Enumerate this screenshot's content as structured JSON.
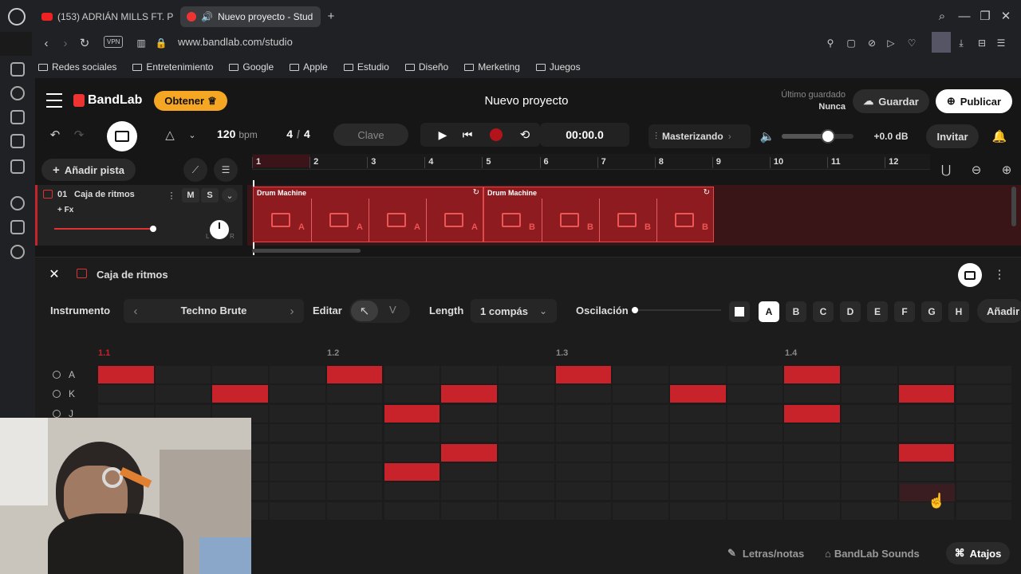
{
  "browser": {
    "tabs": [
      {
        "label": "(153) ADRIÁN MILLS FT. P"
      },
      {
        "label": "Nuevo proyecto - Stud"
      }
    ],
    "url": "www.bandlab.com/studio",
    "vpn": "VPN",
    "bookmarks": [
      {
        "label": "Redes sociales"
      },
      {
        "label": "Entretenimiento"
      },
      {
        "label": "Google"
      },
      {
        "label": "Apple"
      },
      {
        "label": "Estudio"
      },
      {
        "label": "Diseño"
      },
      {
        "label": "Merketing"
      },
      {
        "label": "Juegos"
      }
    ]
  },
  "header": {
    "logo": "BandLab",
    "get_button": "Obtener",
    "project_title": "Nuevo proyecto",
    "last_saved_label": "Último guardado",
    "last_saved_value": "Nunca",
    "save_button": "Guardar",
    "publish_button": "Publicar"
  },
  "transport": {
    "tempo": "120",
    "tempo_unit": "bpm",
    "time_sig_num": "4",
    "time_sig_sep": "/",
    "time_sig_den": "4",
    "key_button": "Clave",
    "time": "00:00.0",
    "mastering": "Masterizando",
    "volume_db": "+0.0 dB",
    "invite": "Invitar",
    "master_volume_fraction": 0.65
  },
  "tracks": {
    "add_track": "Añadir pista",
    "track": {
      "number": "01",
      "name": "Caja de ritmos",
      "fx": "+ Fx",
      "mute": "M",
      "solo": "S",
      "pan_l": "L",
      "pan_r": "R",
      "volume_fraction": 1.0
    }
  },
  "ruler": [
    "1",
    "2",
    "3",
    "4",
    "5",
    "6",
    "7",
    "8",
    "9",
    "10",
    "11",
    "12"
  ],
  "regions": [
    {
      "title": "Drum Machine",
      "pattern": "A"
    },
    {
      "title": "Drum Machine",
      "pattern": "B"
    }
  ],
  "drum": {
    "title": "Caja de ritmos",
    "instrument_label": "Instrumento",
    "instrument_value": "Techno Brute",
    "edit_label": "Editar",
    "edit_v": "V",
    "length_label": "Length",
    "length_value": "1 compás",
    "swing_label": "Oscilación",
    "patterns": [
      "A",
      "B",
      "C",
      "D",
      "E",
      "F",
      "G",
      "H"
    ],
    "selected_pattern": "A",
    "add_label": "Añadir",
    "beats": [
      "1.1",
      "1.2",
      "1.3",
      "1.4"
    ],
    "rows": [
      {
        "label": "A",
        "steps": [
          1,
          0,
          0,
          0,
          1,
          0,
          0,
          0,
          1,
          0,
          0,
          0,
          1,
          0,
          0,
          0
        ]
      },
      {
        "label": "K",
        "steps": [
          0,
          0,
          1,
          0,
          0,
          0,
          1,
          0,
          0,
          0,
          1,
          0,
          0,
          0,
          1,
          0
        ]
      },
      {
        "label": "J",
        "steps": [
          0,
          0,
          0,
          0,
          0,
          1,
          0,
          0,
          0,
          0,
          0,
          0,
          1,
          0,
          0,
          0
        ]
      },
      {
        "label": "",
        "steps": [
          0,
          0,
          0,
          0,
          0,
          0,
          0,
          0,
          0,
          0,
          0,
          0,
          0,
          0,
          0,
          0
        ]
      },
      {
        "label": "",
        "steps": [
          0,
          0,
          0,
          0,
          0,
          0,
          1,
          0,
          0,
          0,
          0,
          0,
          0,
          0,
          1,
          0
        ]
      },
      {
        "label": "",
        "steps": [
          0,
          0,
          0,
          0,
          0,
          1,
          0,
          0,
          0,
          0,
          0,
          0,
          0,
          0,
          0,
          0
        ]
      },
      {
        "label": "",
        "steps": [
          0,
          0,
          0,
          0,
          0,
          0,
          0,
          0,
          0,
          0,
          0,
          0,
          0,
          0,
          0,
          0
        ]
      },
      {
        "label": "",
        "steps": [
          0,
          0,
          0,
          0,
          0,
          0,
          0,
          0,
          0,
          0,
          0,
          0,
          0,
          0,
          0,
          0
        ]
      }
    ]
  },
  "footer": {
    "lyrics": "Letras/notas",
    "sounds": "BandLab Sounds",
    "shortcuts": "Atajos"
  },
  "colors": {
    "accent_red": "#c8232b",
    "brand_orange": "#f5a623",
    "region": "#8e1b20"
  }
}
